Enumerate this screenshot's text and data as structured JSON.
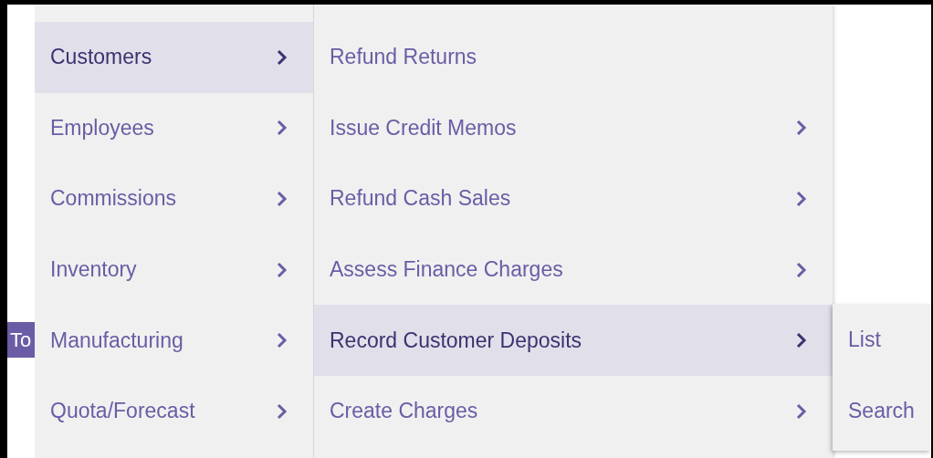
{
  "background_button": {
    "label": "To"
  },
  "menus": [
    {
      "items": [
        {
          "label": "Customers",
          "selected": true,
          "has_submenu": true
        },
        {
          "label": "Employees",
          "selected": false,
          "has_submenu": true
        },
        {
          "label": "Commissions",
          "selected": false,
          "has_submenu": true
        },
        {
          "label": "Inventory",
          "selected": false,
          "has_submenu": true
        },
        {
          "label": "Manufacturing",
          "selected": false,
          "has_submenu": true
        },
        {
          "label": "Quota/Forecast",
          "selected": false,
          "has_submenu": true
        }
      ]
    },
    {
      "items": [
        {
          "label": "Refund Returns",
          "selected": false,
          "has_submenu": false
        },
        {
          "label": "Issue Credit Memos",
          "selected": false,
          "has_submenu": true
        },
        {
          "label": "Refund Cash Sales",
          "selected": false,
          "has_submenu": true
        },
        {
          "label": "Assess Finance Charges",
          "selected": false,
          "has_submenu": true
        },
        {
          "label": "Record Customer Deposits",
          "selected": true,
          "has_submenu": true
        },
        {
          "label": "Create Charges",
          "selected": false,
          "has_submenu": true
        }
      ]
    },
    {
      "items": [
        {
          "label": "List",
          "selected": false,
          "has_submenu": false
        },
        {
          "label": "Search",
          "selected": false,
          "has_submenu": false
        }
      ]
    }
  ]
}
